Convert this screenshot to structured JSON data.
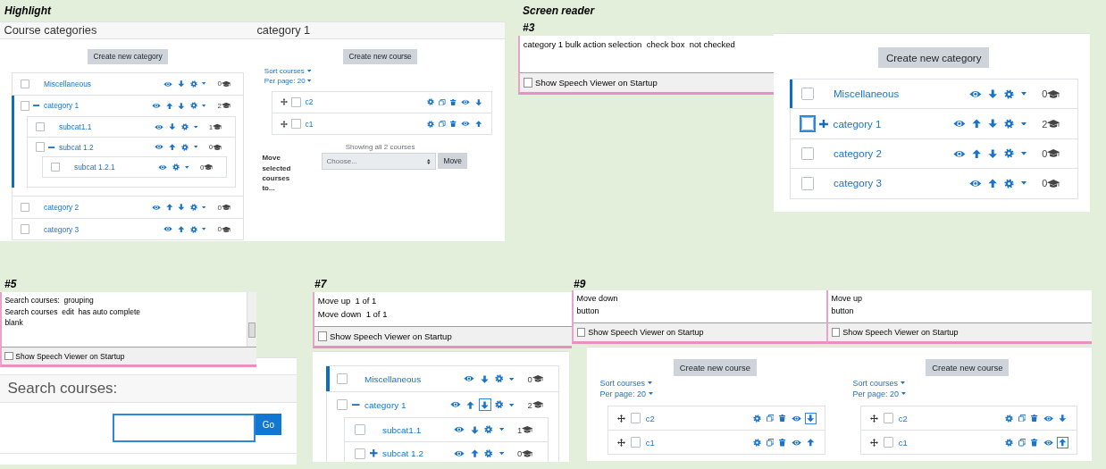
{
  "blocks": [
    {
      "kind": "caption",
      "text": "Highlight"
    },
    {
      "kind": "category_panel",
      "title": "Course categories",
      "button": "Create new category",
      "categories": [
        {
          "name": "Miscellaneous",
          "count": "0",
          "checked": false,
          "selected": false,
          "move_up": false,
          "move_down": true
        },
        {
          "name": "category 1",
          "count": "2",
          "checked": false,
          "selected": true,
          "expanded": true,
          "move_up": true,
          "move_down": true,
          "children": [
            {
              "name": "subcat1.1",
              "count": "1",
              "checked": false,
              "selected": false,
              "move_up": false,
              "move_down": true
            },
            {
              "name": "subcat 1.2",
              "count": "0",
              "checked": false,
              "selected": false,
              "expanded": true,
              "move_up": true,
              "move_down": false,
              "children": [
                {
                  "name": "subcat 1.2.1",
                  "count": "0",
                  "checked": false,
                  "selected": false,
                  "move_up": false,
                  "move_down": false
                }
              ]
            }
          ]
        },
        {
          "name": "category 2",
          "count": "0",
          "checked": false,
          "selected": false,
          "move_up": true,
          "move_down": true
        },
        {
          "name": "category 3",
          "count": "0",
          "checked": false,
          "selected": false,
          "move_up": true,
          "move_down": false
        }
      ]
    },
    {
      "kind": "course_panel",
      "title": "category 1",
      "button": "Create new course",
      "sort": "Sort courses",
      "per_page": "Per page: 20",
      "courses": [
        {
          "name": "c2",
          "checked": false,
          "move_up": false,
          "move_down": true
        },
        {
          "name": "c1",
          "checked": false,
          "move_up": true,
          "move_down": false
        }
      ],
      "footer": {
        "summary": "Showing all 2 courses",
        "move_label": "Move selected courses to...",
        "select_value": "Choose...",
        "move_button": "Move"
      }
    },
    {
      "kind": "caption",
      "text": "Screen reader"
    },
    {
      "kind": "caption",
      "text": "#3"
    },
    {
      "kind": "speech_viewer",
      "lines": [
        "category 1 bulk action selection  check box  not checked"
      ],
      "startup_label": "Show Speech Viewer on Startup",
      "startup_checked": false,
      "scrollable": false
    },
    {
      "kind": "category_panel",
      "button": "Create new category",
      "categories": [
        {
          "name": "Miscellaneous",
          "count": "0",
          "checked": false,
          "selected": true,
          "move_up": false,
          "move_down": true
        },
        {
          "name": "category 1",
          "count": "2",
          "checked": false,
          "selected": false,
          "expanded": false,
          "checkbox_focused": true,
          "move_up": true,
          "move_down": true
        },
        {
          "name": "category 2",
          "count": "0",
          "checked": false,
          "selected": false,
          "move_up": true,
          "move_down": true
        },
        {
          "name": "category 3",
          "count": "0",
          "checked": false,
          "selected": false,
          "move_up": true,
          "move_down": false
        }
      ]
    },
    {
      "kind": "caption",
      "text": "#5"
    },
    {
      "kind": "speech_viewer",
      "lines": [
        "Search courses:  grouping",
        "Search courses  edit  has auto complete",
        "blank"
      ],
      "startup_label": "Show Speech Viewer on Startup",
      "startup_checked": false,
      "scrollable": true
    },
    {
      "kind": "search_panel",
      "title": "Search courses:",
      "button": "Go",
      "input_focused": true
    },
    {
      "kind": "caption",
      "text": "#7"
    },
    {
      "kind": "speech_viewer",
      "lines": [
        "Move up  1 of 1",
        "Move down  1 of 1"
      ],
      "startup_label": "Show Speech Viewer on Startup",
      "startup_checked": false,
      "scrollable": false
    },
    {
      "kind": "category_panel",
      "categories": [
        {
          "name": "Miscellaneous",
          "count": "0",
          "checked": false,
          "selected": true,
          "move_up": false,
          "move_down": true
        },
        {
          "name": "category 1",
          "count": "2",
          "checked": false,
          "selected": false,
          "expanded": true,
          "down_focused": true,
          "move_up": true,
          "move_down": true,
          "children": [
            {
              "name": "subcat1.1",
              "count": "1",
              "checked": false,
              "selected": false,
              "move_up": false,
              "move_down": true
            },
            {
              "name": "subcat 1.2",
              "count": "0",
              "checked": false,
              "selected": false,
              "expanded": false,
              "move_up": true,
              "move_down": false
            }
          ]
        }
      ]
    },
    {
      "kind": "caption",
      "text": "#9"
    },
    {
      "kind": "speech_viewer",
      "lines": [
        "Move down",
        "button"
      ],
      "startup_label": "Show Speech Viewer on Startup",
      "startup_checked": false,
      "scrollable": false
    },
    {
      "kind": "speech_viewer",
      "lines": [
        "Move up",
        "button"
      ],
      "startup_label": "Show Speech Viewer on Startup",
      "startup_checked": false,
      "scrollable": false
    },
    {
      "kind": "course_panel",
      "button": "Create new course",
      "sort": "Sort courses",
      "per_page": "Per page: 20",
      "courses": [
        {
          "name": "c2",
          "checked": false,
          "down_focused": true,
          "move_up": false,
          "move_down": true
        },
        {
          "name": "c1",
          "checked": false,
          "move_up": true,
          "move_down": false
        }
      ]
    },
    {
      "kind": "course_panel",
      "button": "Create new course",
      "sort": "Sort courses",
      "per_page": "Per page: 20",
      "courses": [
        {
          "name": "c2",
          "checked": false,
          "move_up": false,
          "move_down": true
        },
        {
          "name": "c1",
          "checked": false,
          "up_focused": true,
          "move_up": true,
          "move_down": false
        }
      ]
    }
  ]
}
